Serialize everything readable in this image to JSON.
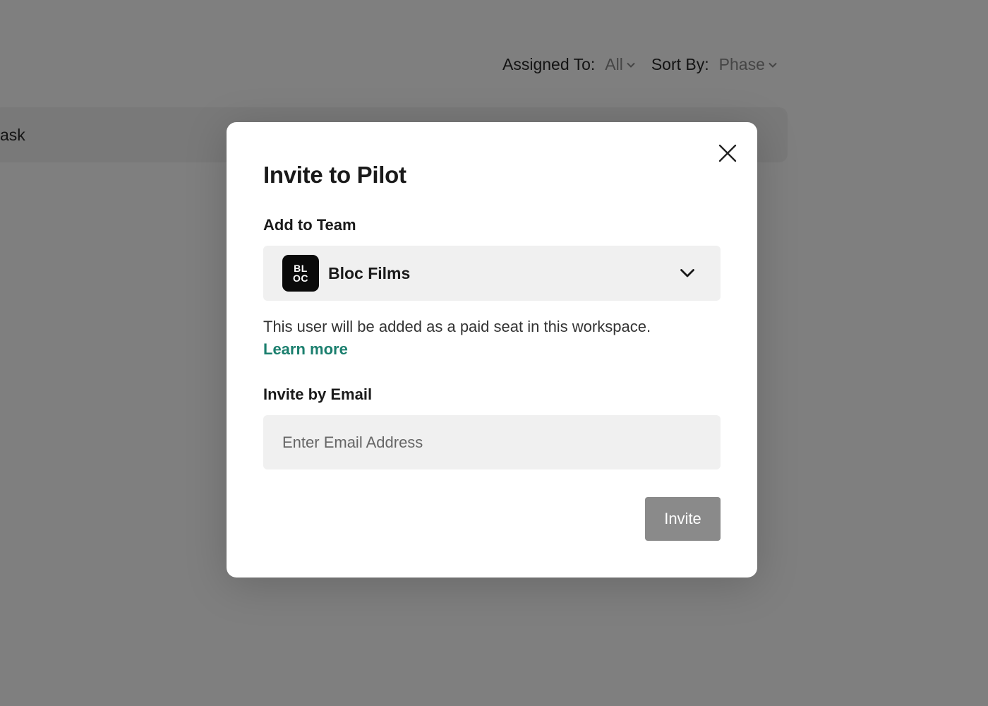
{
  "background": {
    "filters": {
      "assigned_label": "Assigned To:",
      "assigned_value": "All",
      "sort_label": "Sort By:",
      "sort_value": "Phase"
    },
    "task_bar_text": "ask"
  },
  "modal": {
    "title": "Invite to Pilot",
    "team_section_label": "Add to Team",
    "team": {
      "logo_line1": "BL",
      "logo_line2": "OC",
      "name": "Bloc Films"
    },
    "info_text": "This user will be added as a paid seat in this workspace.",
    "learn_more": "Learn more",
    "email_section_label": "Invite by Email",
    "email_value": "",
    "email_placeholder": "Enter Email Address",
    "invite_button": "Invite"
  },
  "colors": {
    "accent_link": "#1b7f6e",
    "invite_button_disabled": "#8a8a8a",
    "overlay": "rgba(0,0,0,0.5)"
  },
  "icons": {
    "close": "close-icon",
    "dropdown": "chevron-down-icon"
  }
}
